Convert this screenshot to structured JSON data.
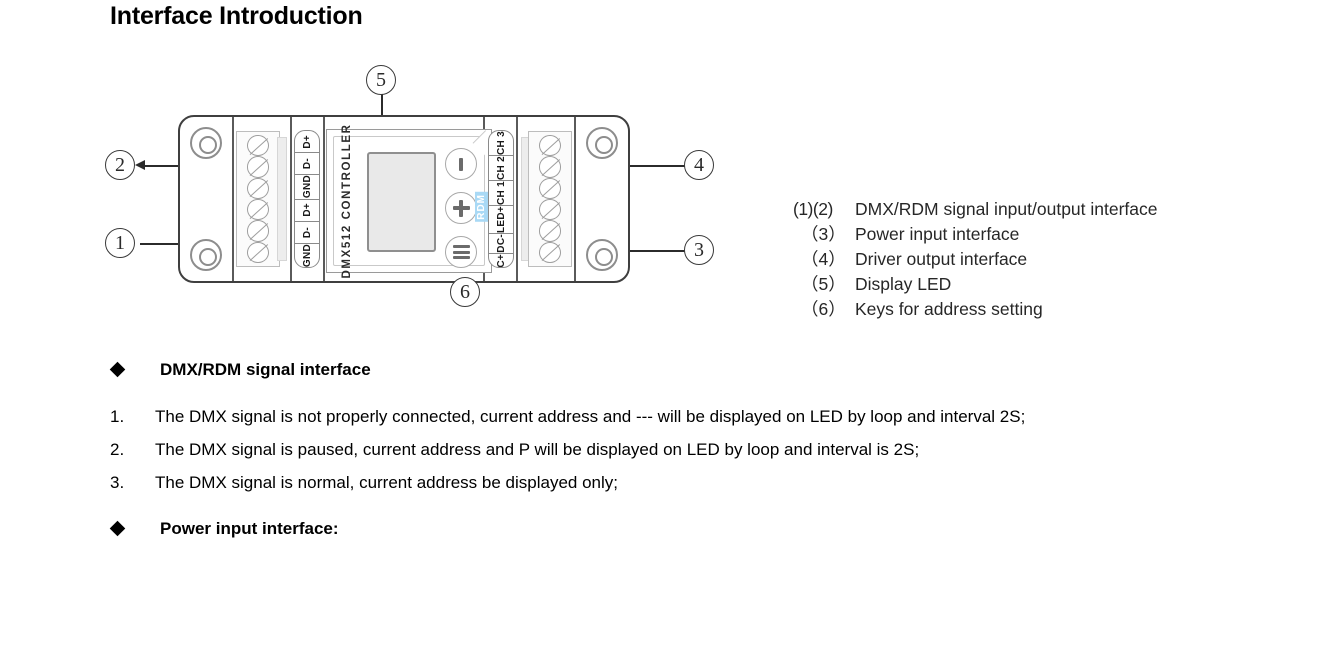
{
  "page_title": "Interface Introduction",
  "figure": {
    "device": {
      "brand_text": "DMX512 CONTROLLER",
      "rdm_badge": "RDM",
      "left_terminal_pins": [
        "D+",
        "D-",
        "GND",
        "D+",
        "D-",
        "GND"
      ],
      "right_terminal_pins": [
        "CH 3",
        "CH 2",
        "CH 1",
        "LED+",
        "DC-",
        "DC+"
      ],
      "buttons": [
        {
          "name": "power-button",
          "glyph": "bar"
        },
        {
          "name": "plus-button",
          "glyph": "plus"
        },
        {
          "name": "minus-button",
          "glyph": "minus"
        }
      ]
    },
    "callouts": [
      {
        "id": "1",
        "label": "1"
      },
      {
        "id": "2",
        "label": "2"
      },
      {
        "id": "3",
        "label": "3"
      },
      {
        "id": "4",
        "label": "4"
      },
      {
        "id": "5",
        "label": "5"
      },
      {
        "id": "6",
        "label": "6"
      }
    ]
  },
  "legend": {
    "rows": [
      {
        "num": "(1)(2)",
        "text": "DMX/RDM signal input/output interface"
      },
      {
        "num": "（3）",
        "text": "Power input interface"
      },
      {
        "num": "（4）",
        "text": "Driver output interface"
      },
      {
        "num": "（5）",
        "text": "Display LED"
      },
      {
        "num": "（6）",
        "text": "Keys for address setting"
      }
    ]
  },
  "body": {
    "heading_1": "DMX/RDM signal interface",
    "items": [
      {
        "n": "1.",
        "text": "The DMX signal is not properly connected, current address and --- will be displayed on LED by loop and interval 2S;"
      },
      {
        "n": "2.",
        "text": "The DMX signal is paused, current address and P will be displayed on LED by loop and interval is 2S;"
      },
      {
        "n": "3.",
        "text": "The DMX signal is normal, current address be displayed only;"
      }
    ],
    "heading_2": "Power input interface:"
  }
}
